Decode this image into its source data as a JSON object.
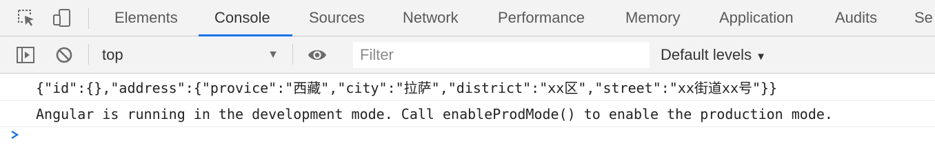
{
  "tabs": [
    {
      "label": "Elements",
      "active": false
    },
    {
      "label": "Console",
      "active": true
    },
    {
      "label": "Sources",
      "active": false
    },
    {
      "label": "Network",
      "active": false
    },
    {
      "label": "Performance",
      "active": false
    },
    {
      "label": "Memory",
      "active": false
    },
    {
      "label": "Application",
      "active": false
    },
    {
      "label": "Audits",
      "active": false
    },
    {
      "label": "Se",
      "active": false
    }
  ],
  "toolbar": {
    "context": "top",
    "filter_placeholder": "Filter",
    "levels_label": "Default levels",
    "levels_arrow": "▼",
    "context_arrow": "▼"
  },
  "console": {
    "messages": [
      "{\"id\":{},\"address\":{\"provice\":\"西藏\",\"city\":\"拉萨\",\"district\":\"xx区\",\"street\":\"xx街道xx号\"}}",
      "Angular is running in the development mode. Call enableProdMode() to enable the production mode."
    ]
  },
  "colors": {
    "accent": "#1a73e8",
    "toolbar_bg": "#f3f3f3"
  },
  "icons": [
    "inspect-element-icon",
    "device-toolbar-icon",
    "sidebar-toggle-icon",
    "clear-console-icon",
    "live-expression-eye-icon",
    "console-prompt-icon"
  ]
}
